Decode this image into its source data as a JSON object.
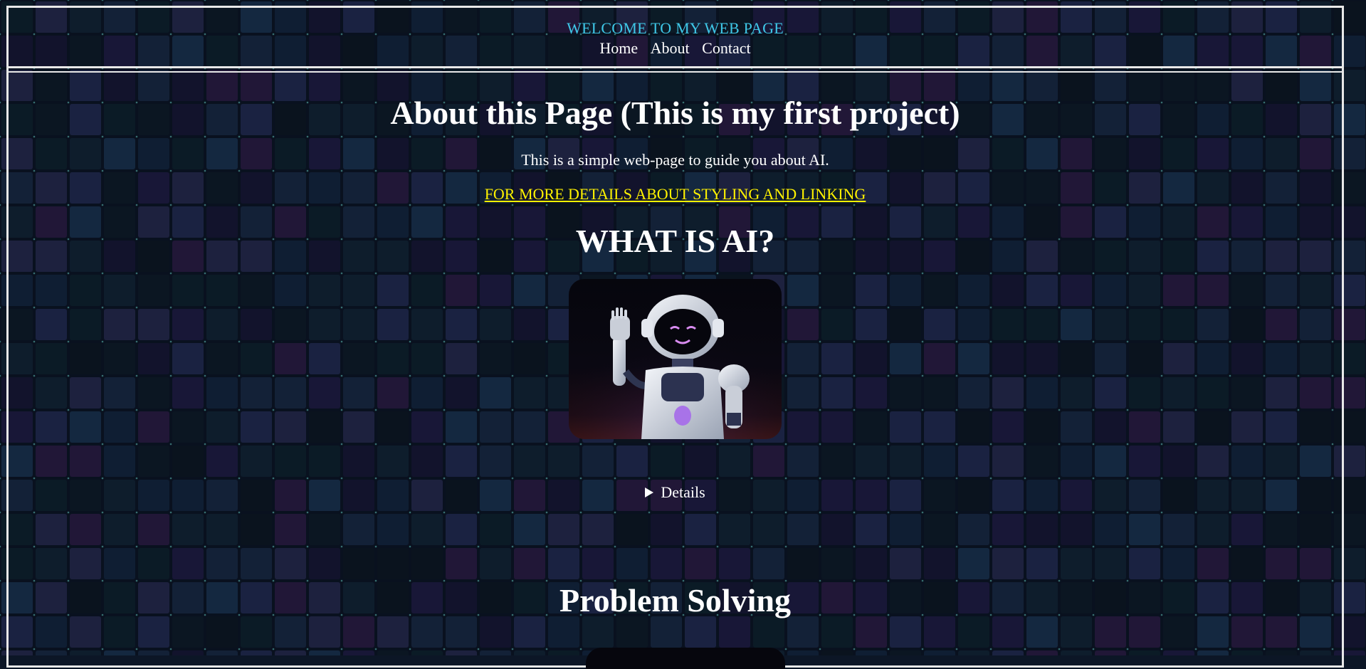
{
  "header": {
    "title": "WELCOME TO MY WEB PAGE",
    "nav": [
      "Home",
      "About",
      "Contact"
    ]
  },
  "about": {
    "heading": "About this Page (This is my first project)",
    "description": "This is a simple web-page to guide you about AI.",
    "link": "FOR MORE DETAILS ABOUT STYLING AND LINKING"
  },
  "ai_section": {
    "heading": "WHAT IS AI?",
    "details_label": "Details"
  },
  "problem_section": {
    "heading": "Problem Solving"
  },
  "colors": {
    "title_color": "#3fc8e8",
    "link_color": "#fff200",
    "text_color": "#ffffff",
    "background": "#0c1626"
  }
}
